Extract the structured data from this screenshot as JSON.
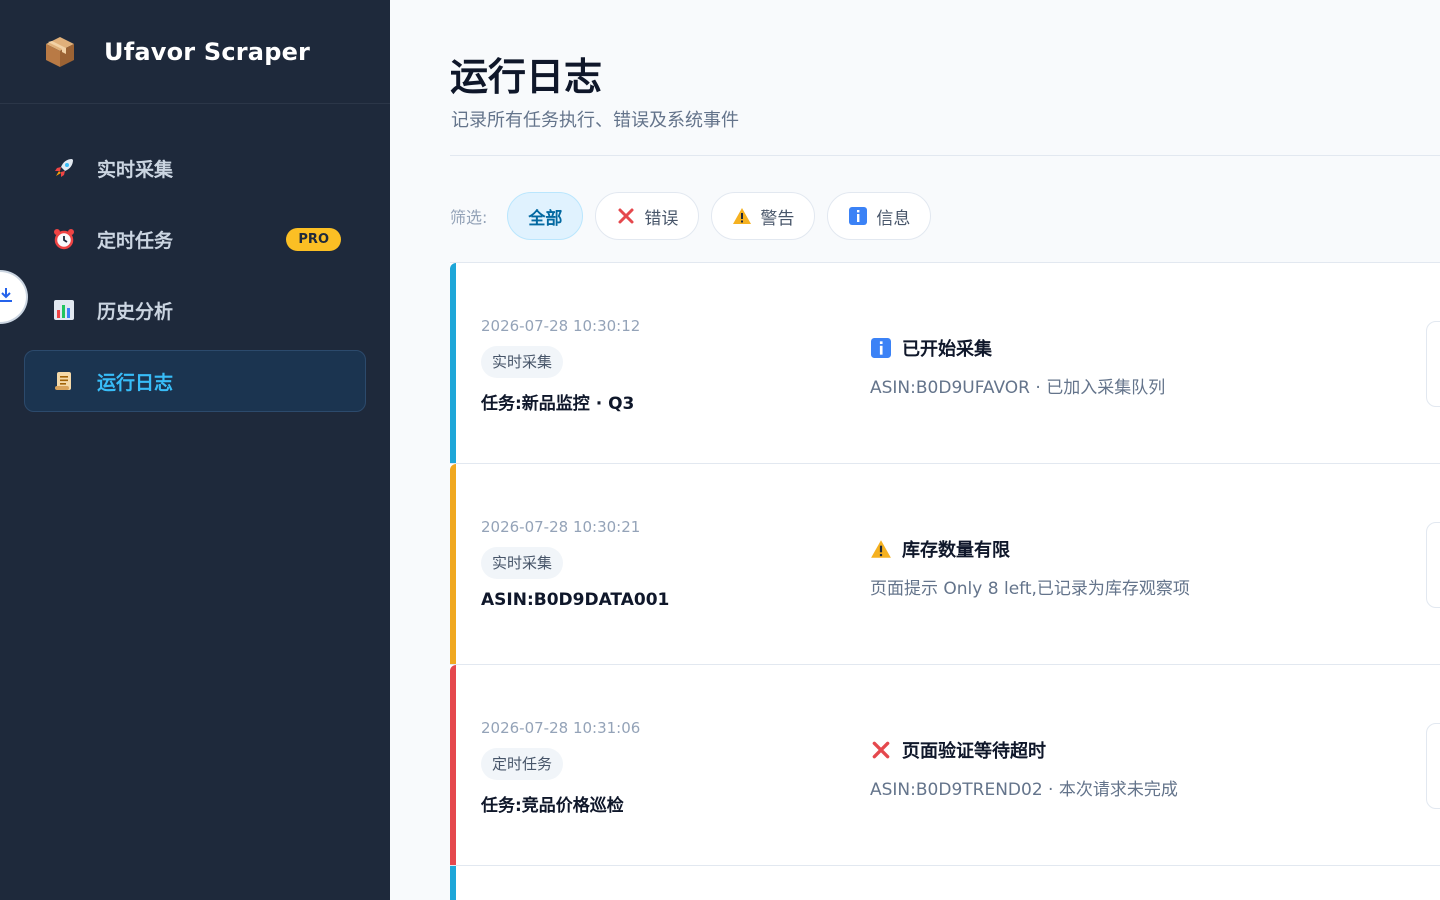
{
  "app": {
    "title": "Ufavor Scraper",
    "icon": "package-icon"
  },
  "sidebar": {
    "items": [
      {
        "label": "实时采集",
        "icon": "rocket-icon",
        "active": false
      },
      {
        "label": "定时任务",
        "icon": "alarm-clock-icon",
        "active": false,
        "badge": "PRO"
      },
      {
        "label": "历史分析",
        "icon": "bar-chart-icon",
        "active": false
      },
      {
        "label": "运行日志",
        "icon": "scroll-icon",
        "active": true
      }
    ]
  },
  "page": {
    "title": "运行日志",
    "subtitle": "记录所有任务执行、错误及系统事件"
  },
  "filters": {
    "label": "筛选:",
    "options": [
      {
        "label": "全部",
        "icon": "",
        "active": true
      },
      {
        "label": "错误",
        "icon": "cross-icon",
        "active": false
      },
      {
        "label": "警告",
        "icon": "warning-icon",
        "active": false
      },
      {
        "label": "信息",
        "icon": "info-icon",
        "active": false
      }
    ]
  },
  "logs": [
    {
      "level": "info",
      "color": "#1ea6d8",
      "time": "2026-07-28 10:30:12",
      "tag": "实时采集",
      "task": "任务:新品监控 · Q3",
      "title": "已开始采集",
      "detail": "ASIN:B0D9UFAVOR · 已加入采集队列"
    },
    {
      "level": "warning",
      "color": "#f0a820",
      "time": "2026-07-28 10:30:21",
      "tag": "实时采集",
      "task": "ASIN:B0D9DATA001",
      "title": "库存数量有限",
      "detail": "页面提示 Only 8 left,已记录为库存观察项"
    },
    {
      "level": "error",
      "color": "#e5484d",
      "time": "2026-07-28 10:31:06",
      "tag": "定时任务",
      "task": "任务:竞品价格巡检",
      "title": "页面验证等待超时",
      "detail": "ASIN:B0D9TREND02 · 本次请求未完成"
    }
  ],
  "colors": {
    "sidebar_bg": "#1e293b",
    "accent": "#38bdf8",
    "pro": "#fbbf24"
  }
}
